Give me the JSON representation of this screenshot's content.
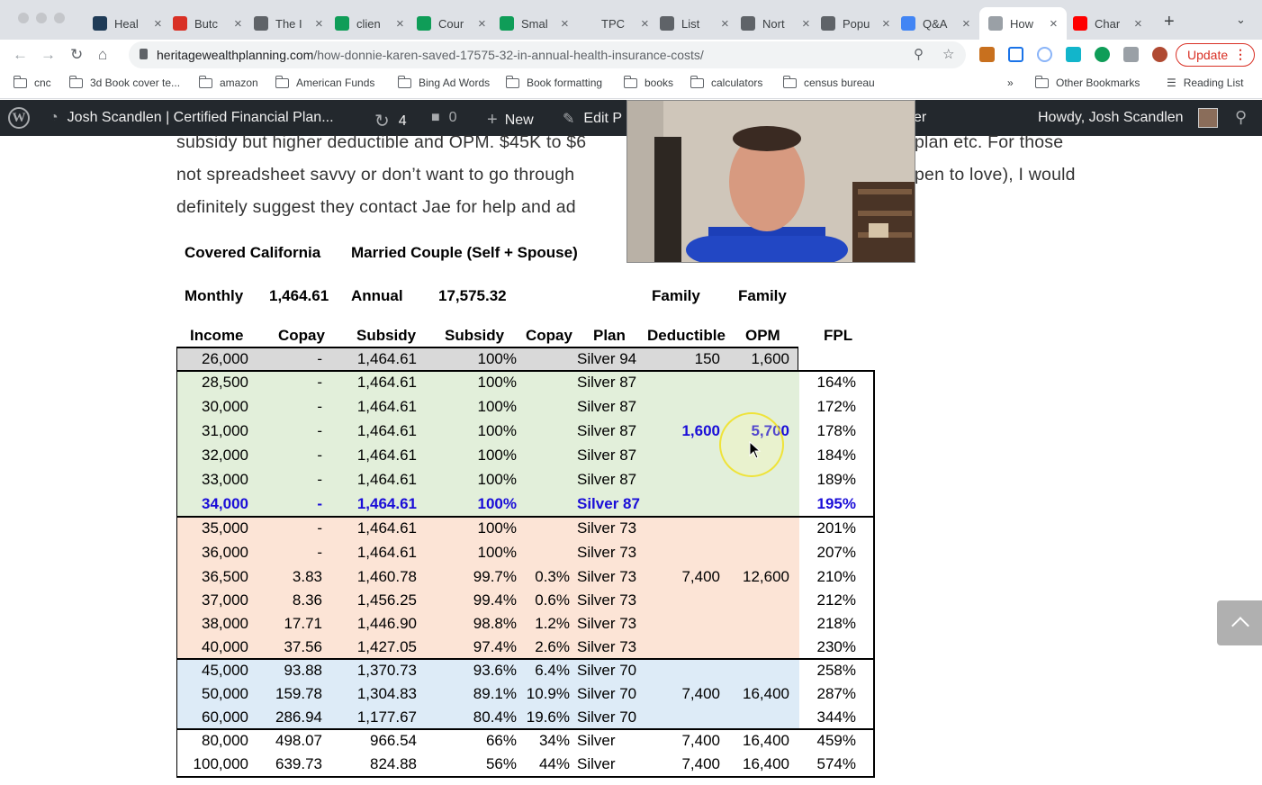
{
  "tabs": [
    {
      "label": "Heal",
      "icon": "hc-icon",
      "color": "#1f3b57"
    },
    {
      "label": "Butc",
      "icon": "butcher-icon",
      "color": "#d93025"
    },
    {
      "label": "The I",
      "icon": "globe-icon",
      "color": "#5f6368"
    },
    {
      "label": "clien",
      "icon": "sheets-icon",
      "color": "#0f9d58"
    },
    {
      "label": "Cour",
      "icon": "sheets-icon",
      "color": "#0f9d58"
    },
    {
      "label": "Smal",
      "icon": "sheets-icon",
      "color": "#0f9d58"
    },
    {
      "label": "TPC",
      "icon": "blank-icon",
      "color": "#dee1e6"
    },
    {
      "label": "List",
      "icon": "globe-icon",
      "color": "#5f6368"
    },
    {
      "label": "Nort",
      "icon": "globe-icon",
      "color": "#5f6368"
    },
    {
      "label": "Popu",
      "icon": "globe-icon",
      "color": "#5f6368"
    },
    {
      "label": "Q&A",
      "icon": "docs-icon",
      "color": "#4285f4"
    },
    {
      "label": "How",
      "icon": "loading-icon",
      "color": "#9aa0a6",
      "active": true
    },
    {
      "label": "Char",
      "icon": "youtube-icon",
      "color": "#ff0000"
    }
  ],
  "address": {
    "host": "heritagewealthplanning.com",
    "path": "/how-donnie-karen-saved-17575-32-in-annual-health-insurance-costs/"
  },
  "toolbar": {
    "update_label": "Update",
    "more_label": "⋮"
  },
  "bookmarks": [
    "cnc",
    "3d Book cover te...",
    "amazon",
    "American Funds",
    "Bing Ad Words",
    "Book formatting",
    "books",
    "calculators",
    "census bureau"
  ],
  "bookmarks_right": {
    "overflow": "»",
    "other": "Other Bookmarks",
    "reading": "Reading List"
  },
  "wpbar": {
    "site": "Josh Scandlen | Certified Financial Plan...",
    "updates": "4",
    "comments": "0",
    "new": "New",
    "edit": "Edit P",
    "hidden_tail": "er",
    "howdy": "Howdy, Josh Scandlen"
  },
  "article": {
    "line1": "subsidy but higher deductible and OPM.  $45K to $6",
    "line1b": "plan etc. For those",
    "line2": "not spreadsheet savvy or don’t want to go through",
    "line2b": "pen to love), I would",
    "line3": "definitely suggest they contact Jae for help and ad"
  },
  "sheet": {
    "title_left": "Covered California",
    "title_right": "Married Couple (Self + Spouse)",
    "monthly_label": "Monthly",
    "monthly_value": "1,464.61",
    "annual_label": "Annual",
    "annual_value": "17,575.32",
    "family1": "Family",
    "family2": "Family",
    "headers": [
      "Income",
      "Copay",
      "Subsidy",
      "Subsidy",
      "Copay",
      "Plan",
      "Deductible",
      "OPM",
      "FPL"
    ],
    "rows": [
      {
        "income": "26,000",
        "copay": "-",
        "subsidy": "1,464.61",
        "pct": "100%",
        "cpct": "",
        "plan": "Silver 94",
        "ded": "150",
        "opm": "1,600",
        "fpl": "",
        "band": "gray"
      },
      {
        "income": "28,500",
        "copay": "-",
        "subsidy": "1,464.61",
        "pct": "100%",
        "cpct": "",
        "plan": "Silver 87",
        "ded": "",
        "opm": "",
        "fpl": "164%",
        "band": "green"
      },
      {
        "income": "30,000",
        "copay": "-",
        "subsidy": "1,464.61",
        "pct": "100%",
        "cpct": "",
        "plan": "Silver 87",
        "ded": "",
        "opm": "",
        "fpl": "172%",
        "band": "green"
      },
      {
        "income": "31,000",
        "copay": "-",
        "subsidy": "1,464.61",
        "pct": "100%",
        "cpct": "",
        "plan": "Silver 87",
        "ded": "1,600",
        "opm": "5,700",
        "fpl": "178%",
        "band": "green",
        "dedhl": true
      },
      {
        "income": "32,000",
        "copay": "-",
        "subsidy": "1,464.61",
        "pct": "100%",
        "cpct": "",
        "plan": "Silver 87",
        "ded": "",
        "opm": "",
        "fpl": "184%",
        "band": "green"
      },
      {
        "income": "33,000",
        "copay": "-",
        "subsidy": "1,464.61",
        "pct": "100%",
        "cpct": "",
        "plan": "Silver 87",
        "ded": "",
        "opm": "",
        "fpl": "189%",
        "band": "green"
      },
      {
        "income": "34,000",
        "copay": "-",
        "subsidy": "1,464.61",
        "pct": "100%",
        "cpct": "",
        "plan": "Silver 87",
        "ded": "",
        "opm": "",
        "fpl": "195%",
        "band": "green",
        "hl": true
      },
      {
        "income": "35,000",
        "copay": "-",
        "subsidy": "1,464.61",
        "pct": "100%",
        "cpct": "",
        "plan": "Silver 73",
        "ded": "",
        "opm": "",
        "fpl": "201%",
        "band": "peach"
      },
      {
        "income": "36,000",
        "copay": "-",
        "subsidy": "1,464.61",
        "pct": "100%",
        "cpct": "",
        "plan": "Silver 73",
        "ded": "",
        "opm": "",
        "fpl": "207%",
        "band": "peach"
      },
      {
        "income": "36,500",
        "copay": "3.83",
        "subsidy": "1,460.78",
        "pct": "99.7%",
        "cpct": "0.3%",
        "plan": "Silver 73",
        "ded": "7,400",
        "opm": "12,600",
        "fpl": "210%",
        "band": "peach"
      },
      {
        "income": "37,000",
        "copay": "8.36",
        "subsidy": "1,456.25",
        "pct": "99.4%",
        "cpct": "0.6%",
        "plan": "Silver 73",
        "ded": "",
        "opm": "",
        "fpl": "212%",
        "band": "peach"
      },
      {
        "income": "38,000",
        "copay": "17.71",
        "subsidy": "1,446.90",
        "pct": "98.8%",
        "cpct": "1.2%",
        "plan": "Silver 73",
        "ded": "",
        "opm": "",
        "fpl": "218%",
        "band": "peach"
      },
      {
        "income": "40,000",
        "copay": "37.56",
        "subsidy": "1,427.05",
        "pct": "97.4%",
        "cpct": "2.6%",
        "plan": "Silver 73",
        "ded": "",
        "opm": "",
        "fpl": "230%",
        "band": "peach"
      },
      {
        "income": "45,000",
        "copay": "93.88",
        "subsidy": "1,370.73",
        "pct": "93.6%",
        "cpct": "6.4%",
        "plan": "Silver 70",
        "ded": "",
        "opm": "",
        "fpl": "258%",
        "band": "blue"
      },
      {
        "income": "50,000",
        "copay": "159.78",
        "subsidy": "1,304.83",
        "pct": "89.1%",
        "cpct": "10.9%",
        "plan": "Silver 70",
        "ded": "7,400",
        "opm": "16,400",
        "fpl": "287%",
        "band": "blue"
      },
      {
        "income": "60,000",
        "copay": "286.94",
        "subsidy": "1,177.67",
        "pct": "80.4%",
        "cpct": "19.6%",
        "plan": "Silver 70",
        "ded": "",
        "opm": "",
        "fpl": "344%",
        "band": "blue"
      },
      {
        "income": "80,000",
        "copay": "498.07",
        "subsidy": "966.54",
        "pct": "66%",
        "cpct": "34%",
        "plan": "Silver",
        "ded": "7,400",
        "opm": "16,400",
        "fpl": "459%",
        "band": "white"
      },
      {
        "income": "100,000",
        "copay": "639.73",
        "subsidy": "824.88",
        "pct": "56%",
        "cpct": "44%",
        "plan": "Silver",
        "ded": "7,400",
        "opm": "16,400",
        "fpl": "574%",
        "band": "white"
      }
    ]
  },
  "colors": {
    "gray": "#d9d9d9",
    "green": "#e2efda",
    "peach": "#fce4d6",
    "blue": "#ddebf7",
    "white": "#ffffff",
    "highlight": "#1a0dd8"
  }
}
